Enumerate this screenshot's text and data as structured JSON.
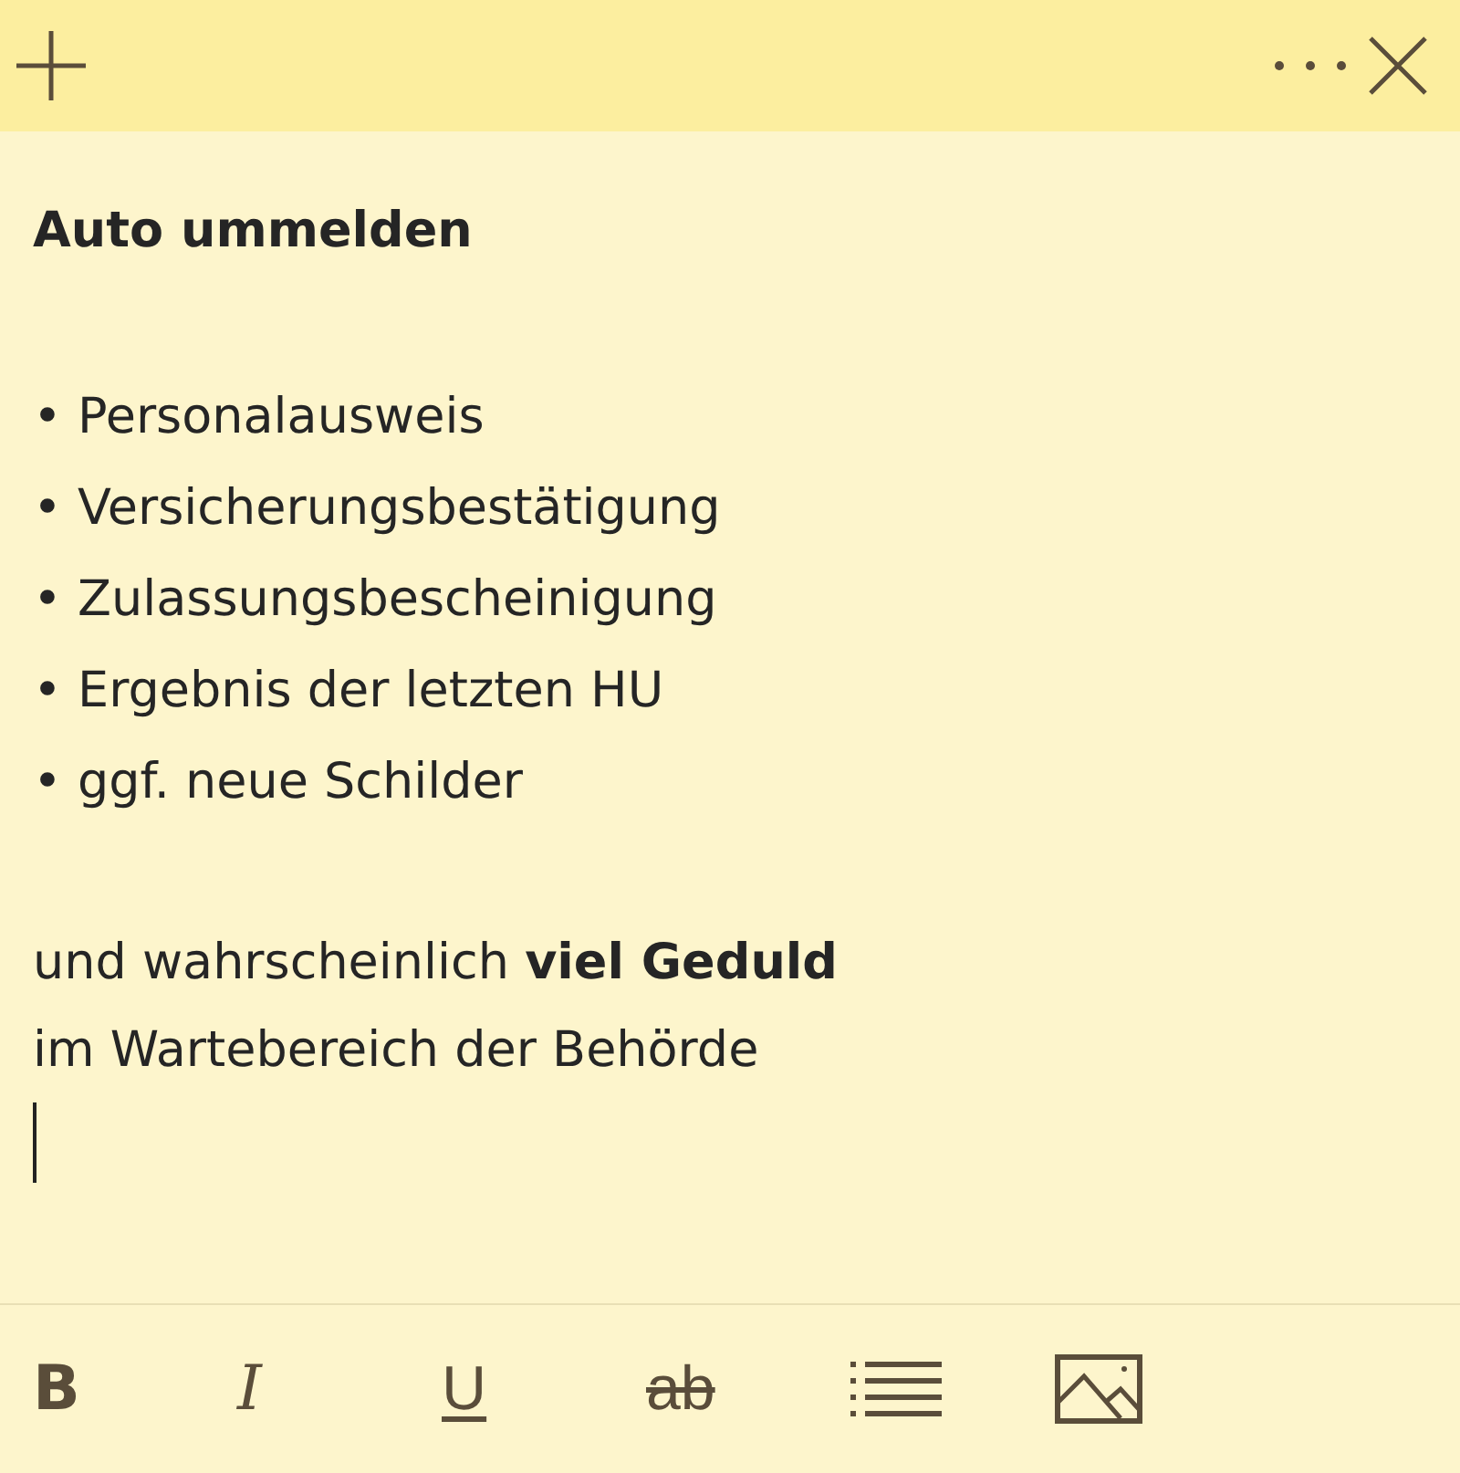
{
  "header": {
    "buttons": [
      {
        "kind": "add"
      },
      {
        "kind": "more"
      },
      {
        "kind": "close"
      }
    ]
  },
  "note": {
    "title": "Auto ummelden",
    "items": [
      "• Personalausweis",
      "• Versicherungsbestätigung",
      "• Zulassungsbescheinigung",
      "• Ergebnis der letzten HU",
      "• ggf. neue Schilder"
    ],
    "paragraph": [
      "und wahrscheinlich **viel Geduld**",
      "im Wartebereich der Behörde"
    ]
  },
  "toolbar": [
    {
      "kind": "bold",
      "label": "B"
    },
    {
      "kind": "italic",
      "label": "I"
    },
    {
      "kind": "underline",
      "label": "U"
    },
    {
      "kind": "strikethrough",
      "label": "ab"
    },
    {
      "kind": "list"
    },
    {
      "kind": "image"
    }
  ]
}
